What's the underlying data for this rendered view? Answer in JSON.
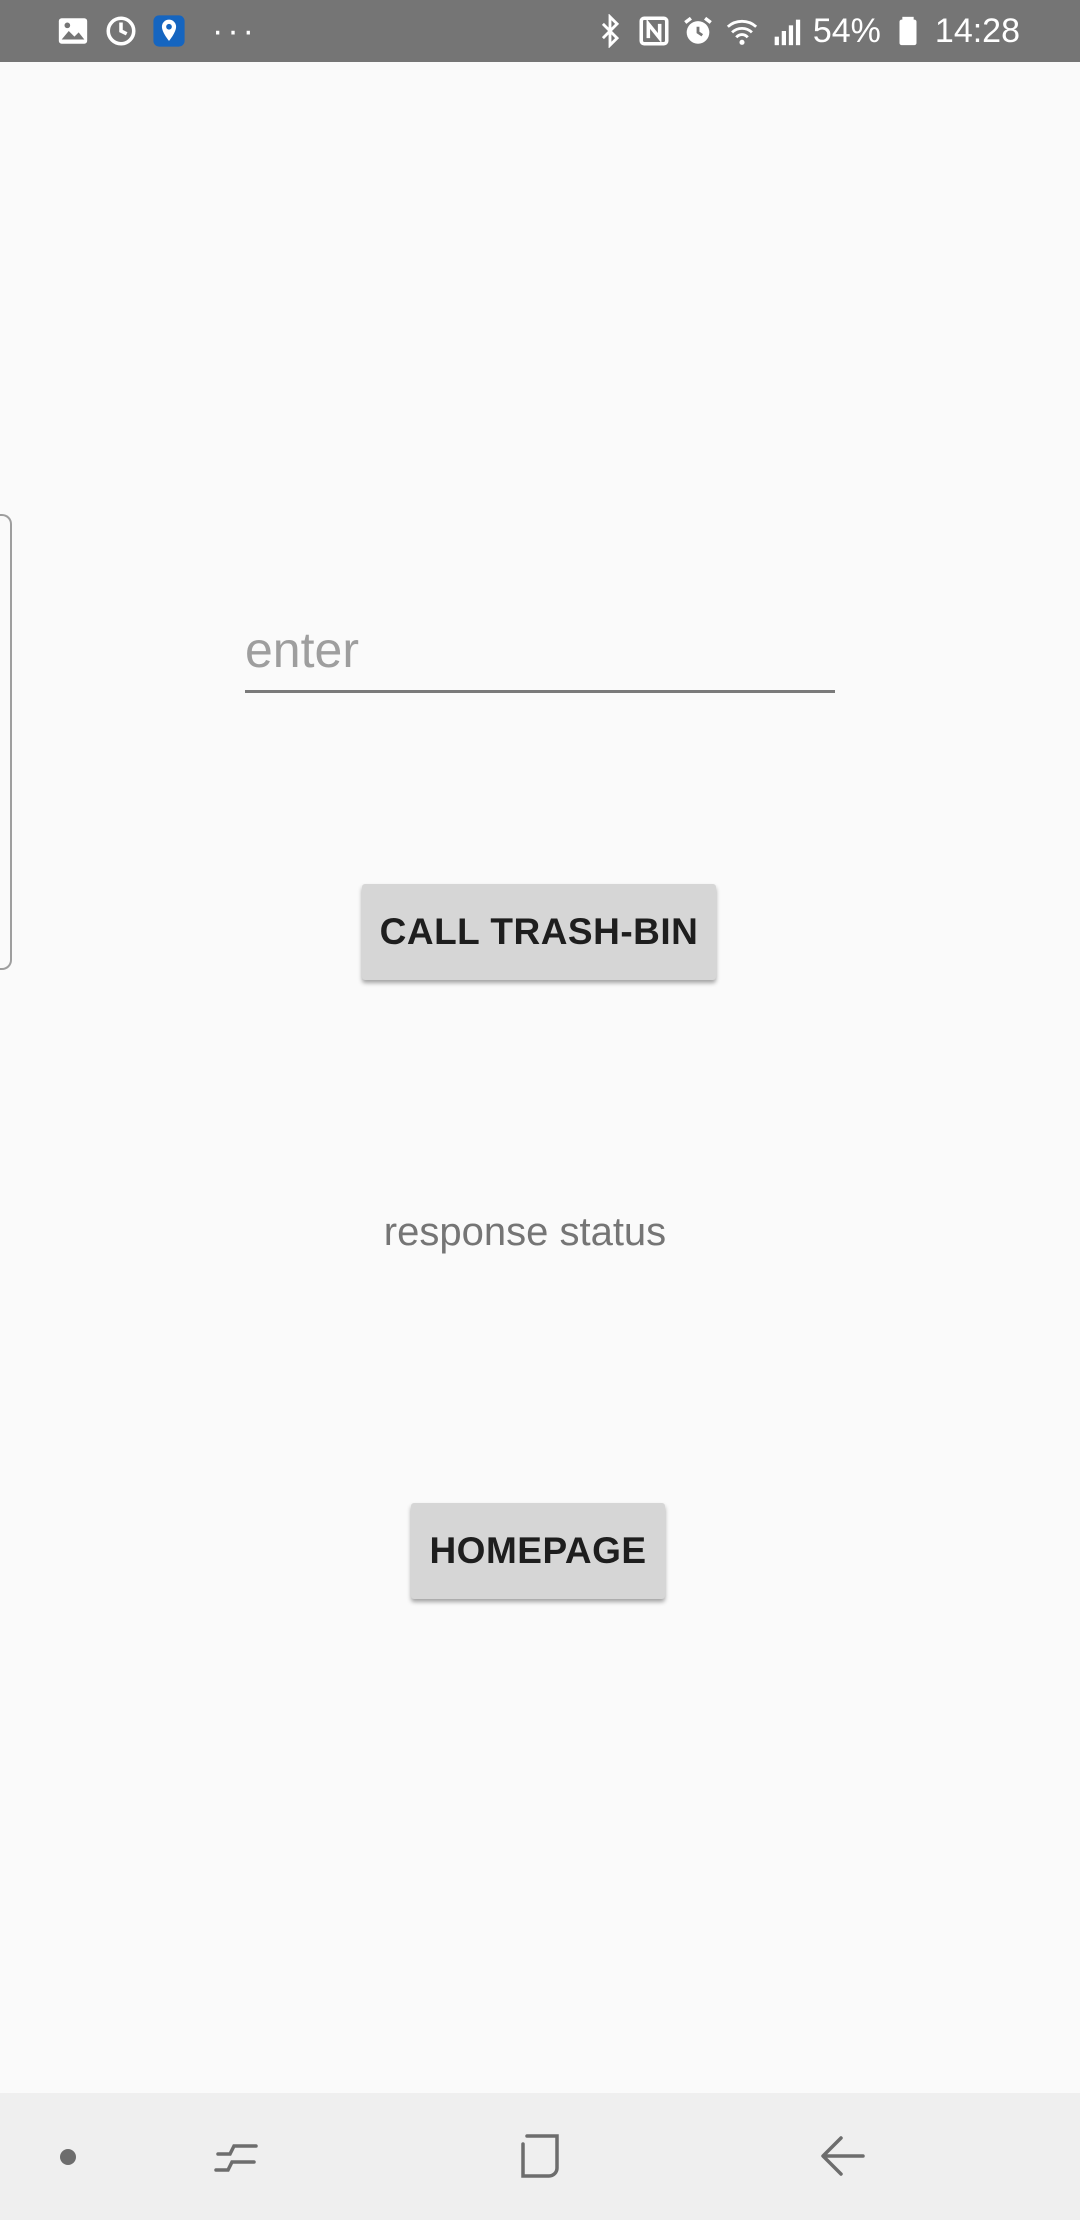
{
  "status_bar": {
    "left_icons": [
      "image-icon",
      "sync-icon",
      "location-icon",
      "more-icon"
    ],
    "more_text": "···",
    "right_icons": [
      "bluetooth-icon",
      "nfc-icon",
      "alarm-icon",
      "wifi-icon",
      "signal-4g-icon"
    ],
    "battery": "54%",
    "time": "14:28"
  },
  "form": {
    "input_value": "",
    "input_placeholder": "enter",
    "call_button_label": "CALL TRASH-BIN",
    "response_status": "response status",
    "homepage_button_label": "HOMEPAGE"
  },
  "nav_bar": {
    "items": [
      "dot-icon",
      "recents-icon",
      "home-icon",
      "back-icon"
    ]
  },
  "colors": {
    "status_bar": "#757575",
    "background": "#fafafa",
    "button": "#d6d6d6",
    "nav_bar": "#efefef"
  }
}
